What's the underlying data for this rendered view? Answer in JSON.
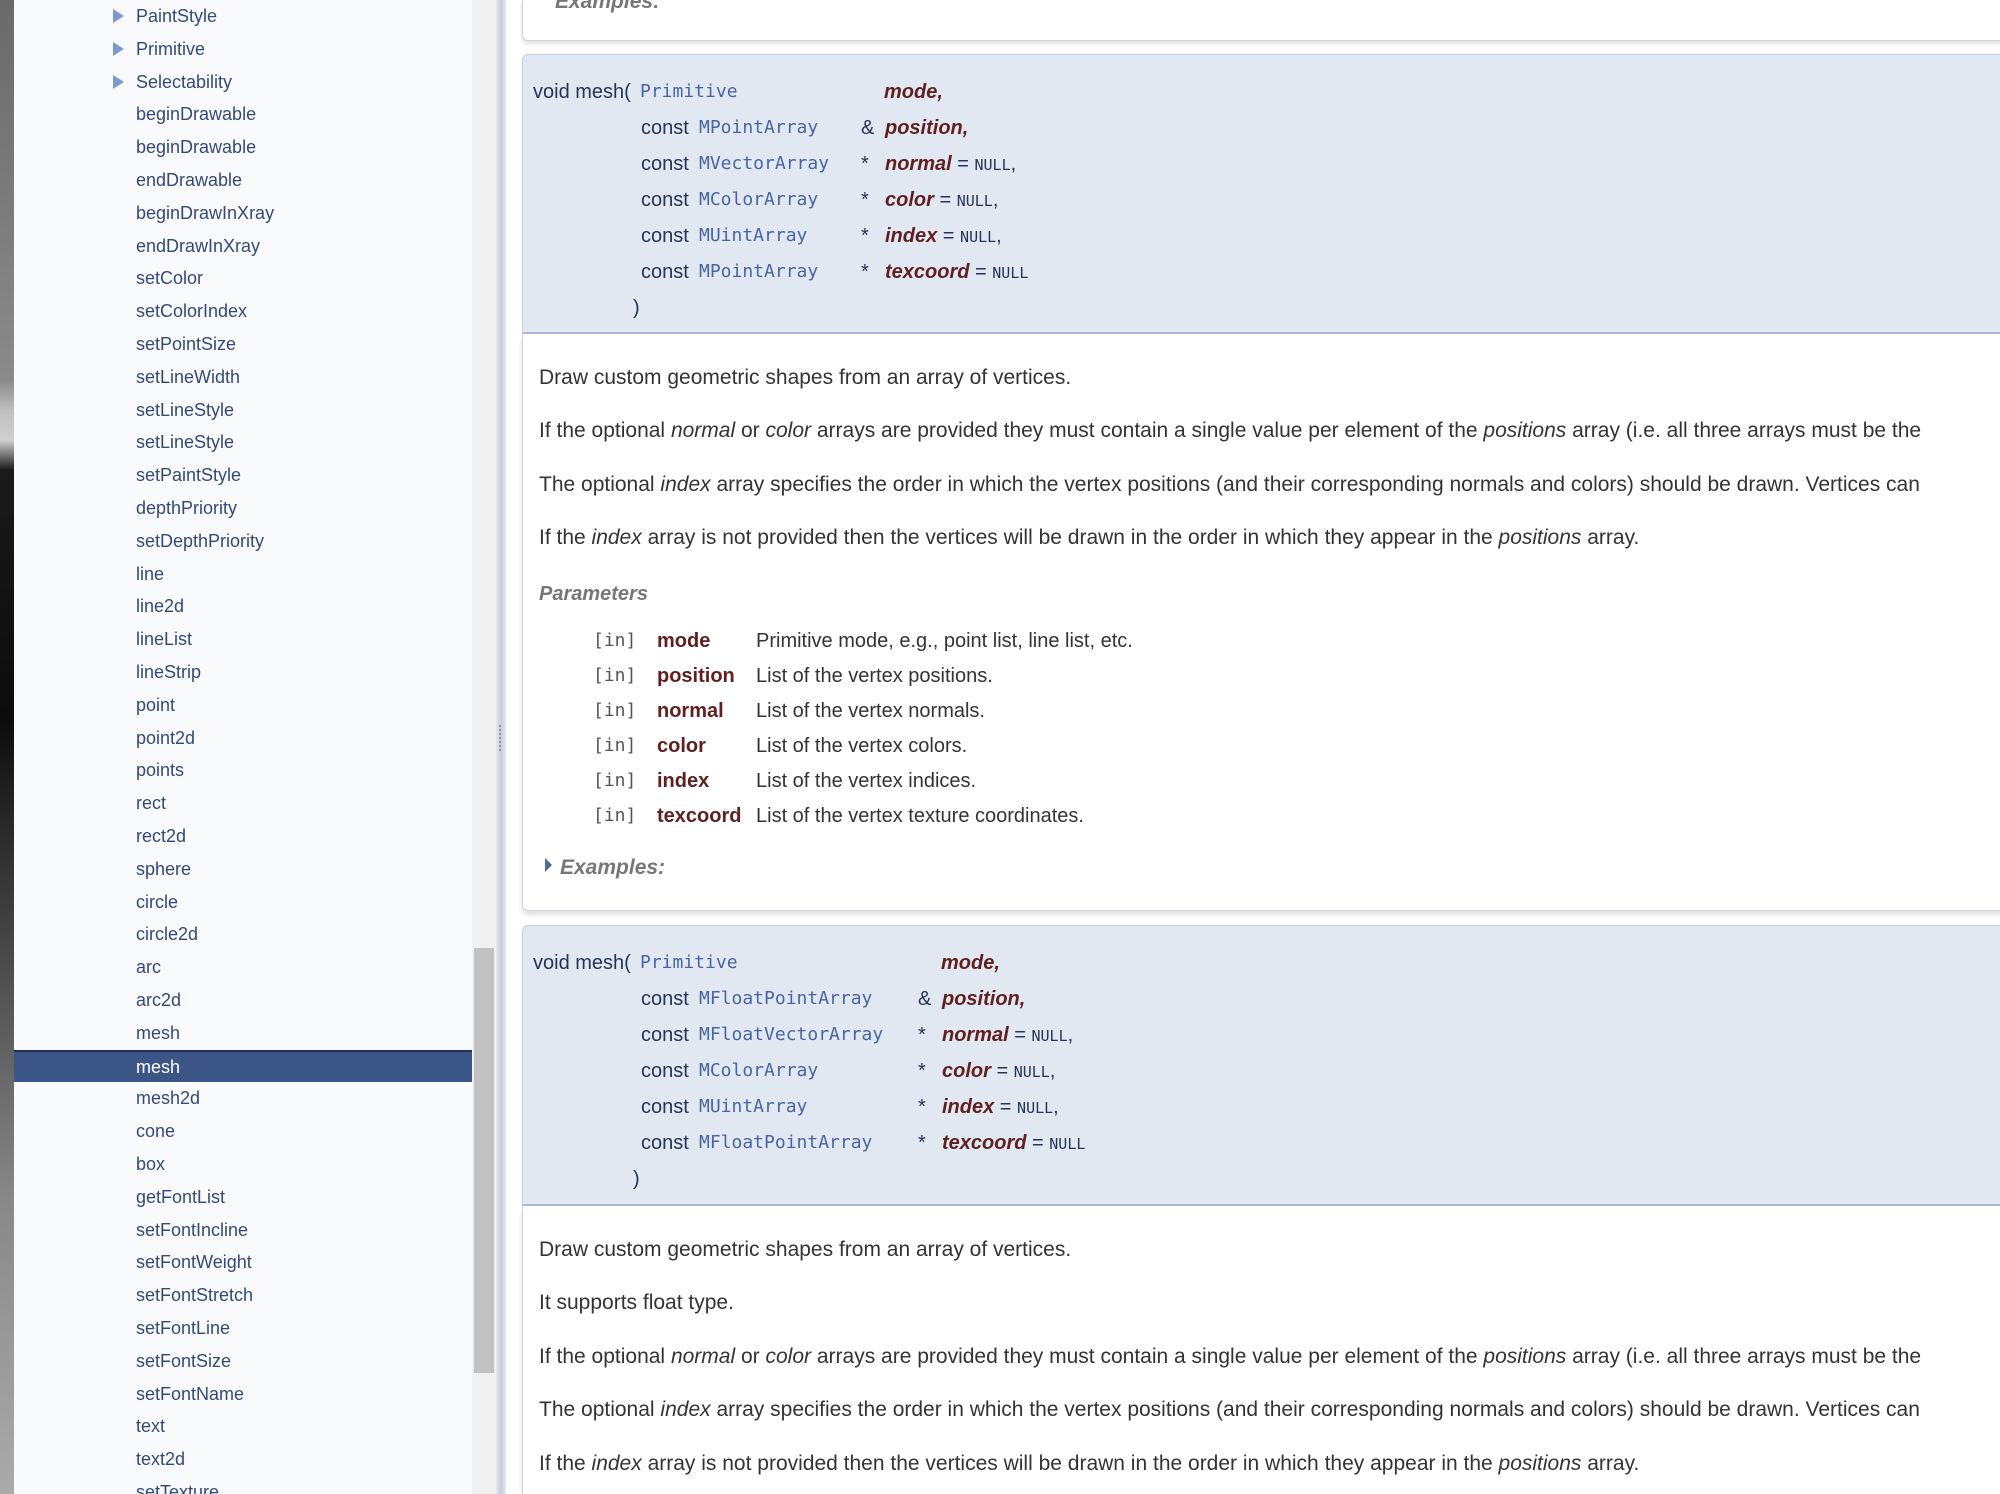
{
  "sidebar": {
    "items": [
      {
        "label": "PaintStyle",
        "expandable": true
      },
      {
        "label": "Primitive",
        "expandable": true
      },
      {
        "label": "Selectability",
        "expandable": true
      },
      {
        "label": "beginDrawable"
      },
      {
        "label": "beginDrawable"
      },
      {
        "label": "endDrawable"
      },
      {
        "label": "beginDrawInXray"
      },
      {
        "label": "endDrawInXray"
      },
      {
        "label": "setColor"
      },
      {
        "label": "setColorIndex"
      },
      {
        "label": "setPointSize"
      },
      {
        "label": "setLineWidth"
      },
      {
        "label": "setLineStyle"
      },
      {
        "label": "setLineStyle"
      },
      {
        "label": "setPaintStyle"
      },
      {
        "label": "depthPriority"
      },
      {
        "label": "setDepthPriority"
      },
      {
        "label": "line"
      },
      {
        "label": "line2d"
      },
      {
        "label": "lineList"
      },
      {
        "label": "lineStrip"
      },
      {
        "label": "point"
      },
      {
        "label": "point2d"
      },
      {
        "label": "points"
      },
      {
        "label": "rect"
      },
      {
        "label": "rect2d"
      },
      {
        "label": "sphere"
      },
      {
        "label": "circle"
      },
      {
        "label": "circle2d"
      },
      {
        "label": "arc"
      },
      {
        "label": "arc2d"
      },
      {
        "label": "mesh"
      },
      {
        "label": "mesh",
        "selected": true
      },
      {
        "label": "mesh2d"
      },
      {
        "label": "cone"
      },
      {
        "label": "box"
      },
      {
        "label": "getFontList"
      },
      {
        "label": "setFontIncline"
      },
      {
        "label": "setFontWeight"
      },
      {
        "label": "setFontStretch"
      },
      {
        "label": "setFontLine"
      },
      {
        "label": "setFontSize"
      },
      {
        "label": "setFontName"
      },
      {
        "label": "text"
      },
      {
        "label": "text2d"
      },
      {
        "label": "setTexture"
      }
    ]
  },
  "top_examples_label": "Examples:",
  "mesh1": {
    "ret": "void mesh",
    "open": "(",
    "close": ")",
    "params": [
      {
        "const": "",
        "type": "Primitive",
        "mod": "",
        "name": "mode,",
        "def": "",
        "tail": ""
      },
      {
        "const": "const",
        "type": "MPointArray",
        "mod": "&",
        "name": "position,",
        "def": "",
        "tail": ""
      },
      {
        "const": "const",
        "type": "MVectorArray",
        "mod": "*",
        "name": "normal",
        "def": "NULL",
        "tail": ","
      },
      {
        "const": "const",
        "type": "MColorArray",
        "mod": "*",
        "name": "color",
        "def": "NULL",
        "tail": ","
      },
      {
        "const": "const",
        "type": "MUintArray",
        "mod": "*",
        "name": "index",
        "def": "NULL",
        "tail": ","
      },
      {
        "const": "const",
        "type": "MPointArray",
        "mod": "*",
        "name": "texcoord",
        "def": "NULL",
        "tail": ""
      }
    ],
    "desc1": "Draw custom geometric shapes from an array of vertices.",
    "p_normal_a": "If the optional ",
    "p_normal_b": "normal",
    "p_normal_c": " or ",
    "p_normal_d": "color",
    "p_normal_e": " arrays are provided they must contain a single value per element of the ",
    "p_normal_f": "positions",
    "p_normal_g": " array (i.e. all three arrays must be the",
    "p_index_a": "The optional ",
    "p_index_b": "index",
    "p_index_c": " array specifies the order in which the vertex positions (and their corresponding normals and colors) should be drawn. Vertices can",
    "p_noidx_a": "If the ",
    "p_noidx_b": "index",
    "p_noidx_c": " array is not provided then the vertices will be drawn in the order in which they appear in the ",
    "p_noidx_d": "positions",
    "p_noidx_e": " array.",
    "params_title": "Parameters",
    "param_docs": [
      {
        "dir": "[in]",
        "name": "mode",
        "desc": "Primitive mode, e.g., point list, line list, etc."
      },
      {
        "dir": "[in]",
        "name": "position",
        "desc": "List of the vertex positions."
      },
      {
        "dir": "[in]",
        "name": "normal",
        "desc": "List of the vertex normals."
      },
      {
        "dir": "[in]",
        "name": "color",
        "desc": "List of the vertex colors."
      },
      {
        "dir": "[in]",
        "name": "index",
        "desc": "List of the vertex indices."
      },
      {
        "dir": "[in]",
        "name": "texcoord",
        "desc": "List of the vertex texture coordinates."
      }
    ],
    "examples": "Examples:"
  },
  "mesh2": {
    "ret": "void mesh",
    "open": "(",
    "close": ")",
    "params": [
      {
        "const": "",
        "type": "Primitive",
        "mod": "",
        "name": "mode,",
        "def": "",
        "tail": ""
      },
      {
        "const": "const",
        "type": "MFloatPointArray",
        "mod": "&",
        "name": "position,",
        "def": "",
        "tail": ""
      },
      {
        "const": "const",
        "type": "MFloatVectorArray",
        "mod": "*",
        "name": "normal",
        "def": "NULL",
        "tail": ","
      },
      {
        "const": "const",
        "type": "MColorArray",
        "mod": "*",
        "name": "color",
        "def": "NULL",
        "tail": ","
      },
      {
        "const": "const",
        "type": "MUintArray",
        "mod": "*",
        "name": "index",
        "def": "NULL",
        "tail": ","
      },
      {
        "const": "const",
        "type": "MFloatPointArray",
        "mod": "*",
        "name": "texcoord",
        "def": "NULL",
        "tail": ""
      }
    ],
    "desc1": "Draw custom geometric shapes from an array of vertices.",
    "desc2": "It supports float type.",
    "p_normal_a": "If the optional ",
    "p_normal_b": "normal",
    "p_normal_c": " or ",
    "p_normal_d": "color",
    "p_normal_e": " arrays are provided they must contain a single value per element of the ",
    "p_normal_f": "positions",
    "p_normal_g": " array (i.e. all three arrays must be the",
    "p_index_a": "The optional ",
    "p_index_b": "index",
    "p_index_c": " array specifies the order in which the vertex positions (and their corresponding normals and colors) should be drawn. Vertices can",
    "p_noidx_a": "If the ",
    "p_noidx_b": "index",
    "p_noidx_c": " array is not provided then the vertices will be drawn in the order in which they appear in the ",
    "p_noidx_d": "positions",
    "p_noidx_e": " array."
  }
}
